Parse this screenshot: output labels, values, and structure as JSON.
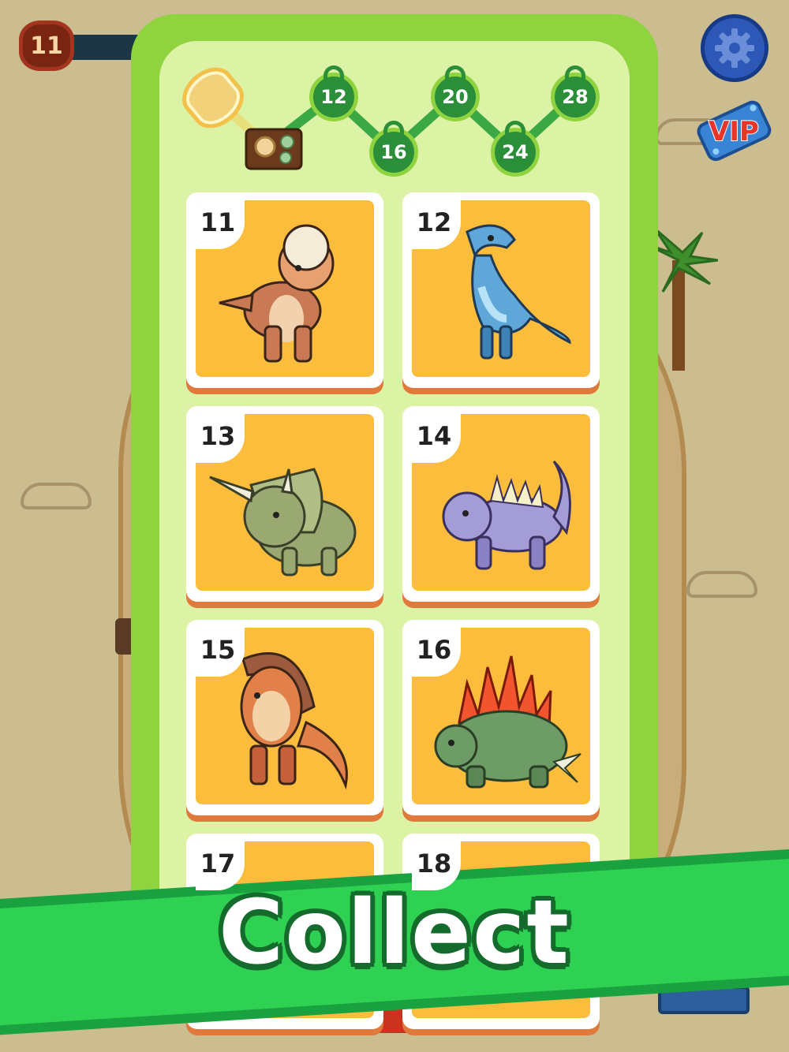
{
  "player": {
    "level": "11"
  },
  "buttons": {
    "settings_icon": "gear-icon",
    "vip_label": "VIP"
  },
  "progress": {
    "milestones": [
      "12",
      "16",
      "20",
      "24",
      "28"
    ],
    "start_reward_icon": "egg-icon",
    "first_reward_icon": "fossil-icon"
  },
  "cards": [
    {
      "number": "11",
      "creature": "pachycephalosaurus"
    },
    {
      "number": "12",
      "creature": "allosaurus"
    },
    {
      "number": "13",
      "creature": "triceratops"
    },
    {
      "number": "14",
      "creature": "ankylosaur"
    },
    {
      "number": "15",
      "creature": "parasaurolophus"
    },
    {
      "number": "16",
      "creature": "stegosaurus"
    },
    {
      "number": "17",
      "creature": ""
    },
    {
      "number": "18",
      "creature": ""
    }
  ],
  "banner": {
    "text": "Collect"
  },
  "colors": {
    "panel": "#8fd43f",
    "card": "#fcbd3c",
    "banner": "#2fd153",
    "node": "#2b8f3a"
  }
}
